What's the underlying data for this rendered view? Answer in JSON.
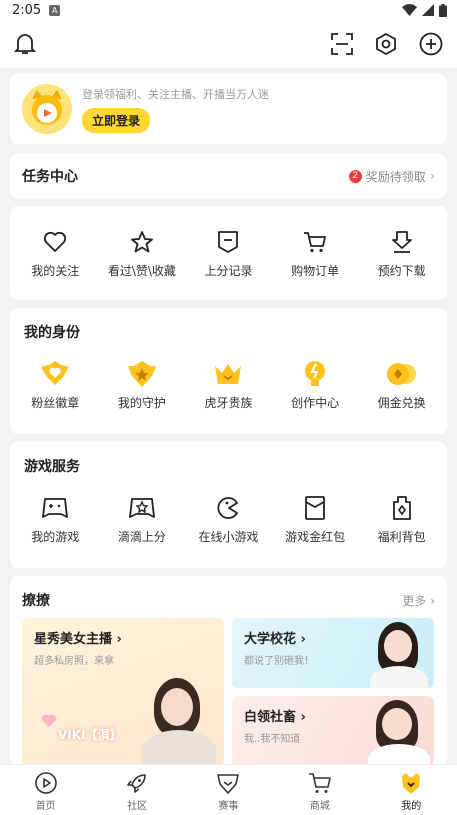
{
  "status": {
    "time": "2:05",
    "notif_glyph": "A"
  },
  "login": {
    "hint": "登录领福利、关注主播、开播当万人迷",
    "button": "立即登录"
  },
  "task": {
    "title": "任务中心",
    "badge": "2",
    "reward_text": "奖励待领取"
  },
  "shortcuts": [
    {
      "label": "我的关注",
      "icon": "heart-icon"
    },
    {
      "label": "看过\\赞\\收藏",
      "icon": "star-icon"
    },
    {
      "label": "上分记录",
      "icon": "shield-record-icon"
    },
    {
      "label": "购物订单",
      "icon": "cart-icon"
    },
    {
      "label": "预约下载",
      "icon": "download-icon"
    }
  ],
  "identity": {
    "title": "我的身份",
    "items": [
      {
        "label": "粉丝徽章",
        "icon": "fan-badge-icon"
      },
      {
        "label": "我的守护",
        "icon": "guard-badge-icon"
      },
      {
        "label": "虎牙贵族",
        "icon": "crown-icon"
      },
      {
        "label": "创作中心",
        "icon": "bulb-icon"
      },
      {
        "label": "佣金兑换",
        "icon": "coins-icon"
      }
    ]
  },
  "games": {
    "title": "游戏服务",
    "items": [
      {
        "label": "我的游戏",
        "icon": "gamepad-icon"
      },
      {
        "label": "滴滴上分",
        "icon": "gamepad-star-icon"
      },
      {
        "label": "在线小游戏",
        "icon": "pacman-icon"
      },
      {
        "label": "游戏金红包",
        "icon": "red-envelope-icon"
      },
      {
        "label": "福利背包",
        "icon": "bag-icon"
      }
    ]
  },
  "liao": {
    "title": "撩撩",
    "more": "更多",
    "big": {
      "title": "星秀美女主播",
      "sub": "超多私房照，来拿",
      "name": "VIKI【浿】"
    },
    "tile1": {
      "title": "大学校花",
      "sub": "都说了别砸我！"
    },
    "tile2": {
      "title": "白领社畜",
      "sub": "我..我不知道"
    }
  },
  "tabs": [
    {
      "label": "首页",
      "icon": "home-play-icon"
    },
    {
      "label": "社区",
      "icon": "rocket-icon"
    },
    {
      "label": "赛事",
      "icon": "trophy-icon"
    },
    {
      "label": "商城",
      "icon": "cart-icon"
    },
    {
      "label": "我的",
      "icon": "tiger-profile-icon"
    }
  ],
  "colors": {
    "accent": "#ffd633",
    "badge": "#f23c3c",
    "background": "#f3f3f5"
  }
}
